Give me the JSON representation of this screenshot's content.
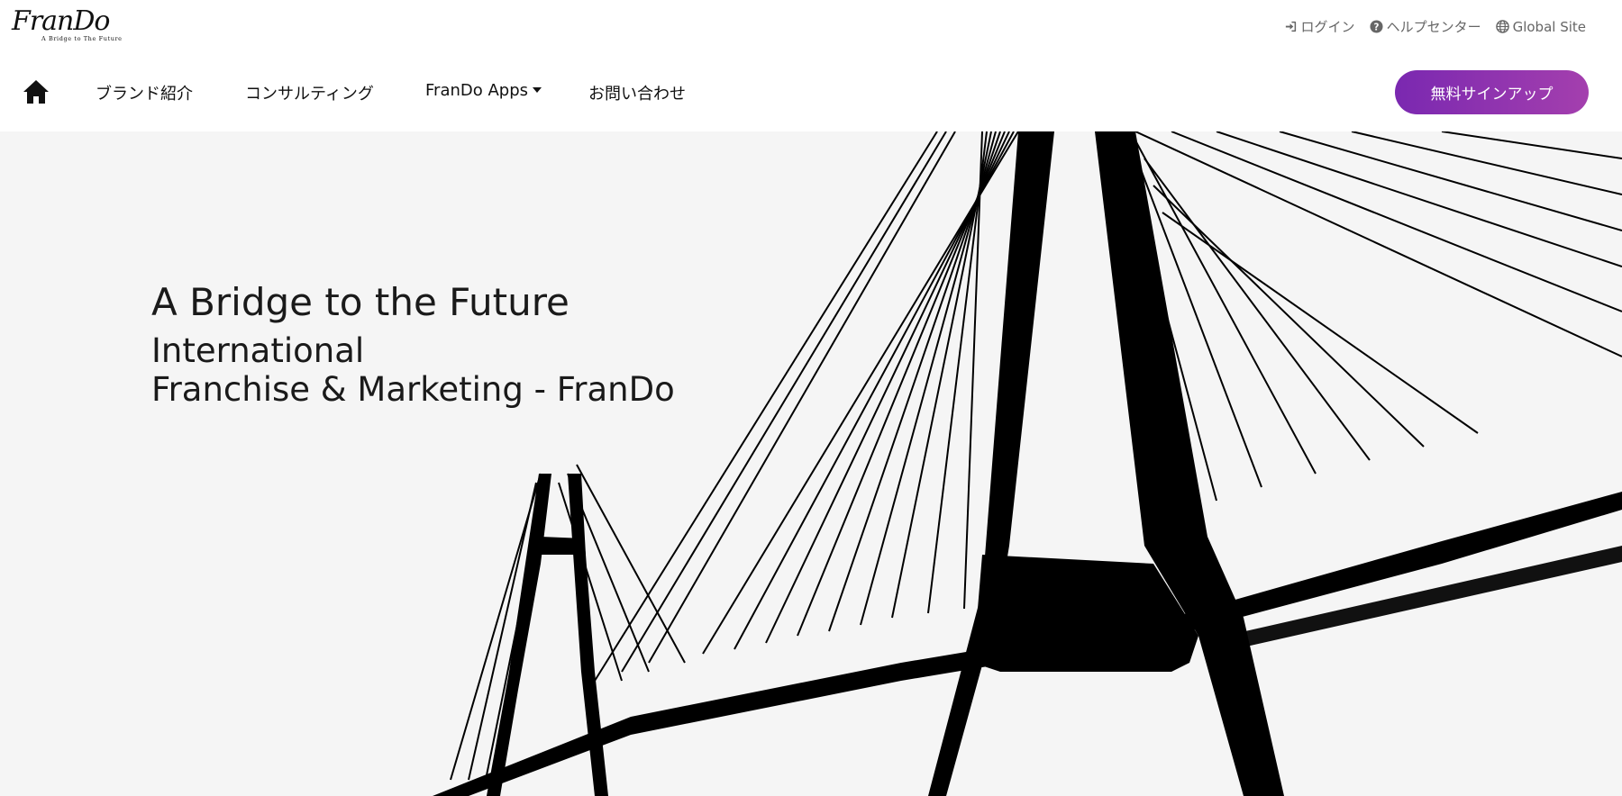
{
  "logo": {
    "name": "FranDo",
    "tagline": "A Bridge to The Future"
  },
  "utility": [
    {
      "label": "ログイン",
      "icon": "login-icon"
    },
    {
      "label": "ヘルプセンター",
      "icon": "question-circle-icon"
    },
    {
      "label": "Global Site",
      "icon": "globe-icon"
    }
  ],
  "nav": {
    "home_icon": "home-icon",
    "items": [
      {
        "label": "ブランド紹介"
      },
      {
        "label": "コンサルティング"
      },
      {
        "label": "FranDo Apps",
        "has_dropdown": true
      },
      {
        "label": "お問い合わせ"
      }
    ],
    "signup_label": "無料サインアップ"
  },
  "hero": {
    "title": "A Bridge to the Future",
    "subtitle_line1": "International",
    "subtitle_line2": "Franchise & Marketing - FranDo"
  },
  "colors": {
    "accent_start": "#7a28b0",
    "accent_end": "#a43fae",
    "hero_bg": "#f5f5f5"
  }
}
